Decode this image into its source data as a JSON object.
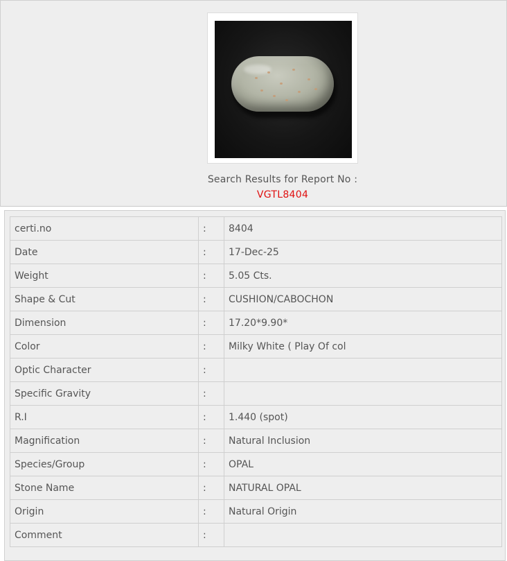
{
  "search": {
    "label": "Search Results for Report No :",
    "report_no": "VGTL8404"
  },
  "colors": {
    "report_no": "#e01010",
    "panel_bg": "#eeeeee",
    "text": "#555555"
  },
  "details": {
    "separator": ":",
    "rows": [
      {
        "label": "certi.no",
        "value": "8404"
      },
      {
        "label": "Date",
        "value": "17-Dec-25"
      },
      {
        "label": "Weight",
        "value": "5.05 Cts."
      },
      {
        "label": "Shape & Cut",
        "value": "CUSHION/CABOCHON"
      },
      {
        "label": "Dimension",
        "value": "17.20*9.90*"
      },
      {
        "label": "Color",
        "value": "Milky White ( Play Of col"
      },
      {
        "label": "Optic Character",
        "value": ""
      },
      {
        "label": "Specific Gravity",
        "value": ""
      },
      {
        "label": "R.I",
        "value": "1.440 (spot)"
      },
      {
        "label": "Magnification",
        "value": "Natural Inclusion"
      },
      {
        "label": "Species/Group",
        "value": "OPAL"
      },
      {
        "label": "Stone Name",
        "value": "NATURAL OPAL"
      },
      {
        "label": "Origin",
        "value": "Natural Origin"
      },
      {
        "label": "Comment",
        "value": ""
      }
    ]
  }
}
